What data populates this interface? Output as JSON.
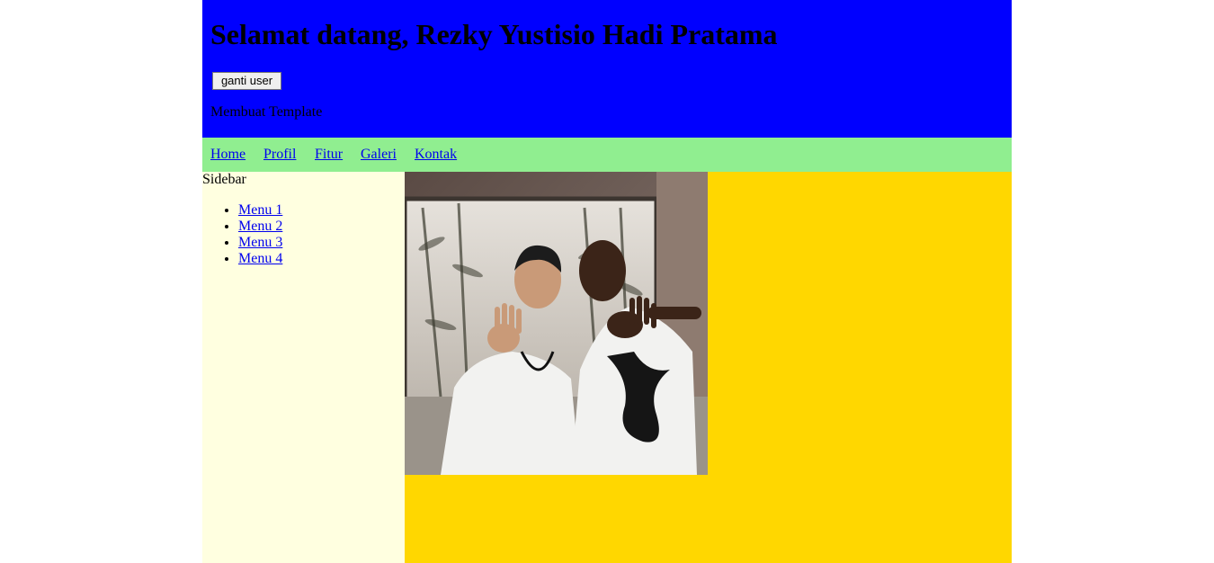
{
  "header": {
    "title": "Selamat datang, Rezky Yustisio Hadi Pratama",
    "switch_user_label": "ganti user",
    "subtitle": "Membuat Template"
  },
  "nav": {
    "items": [
      {
        "label": "Home"
      },
      {
        "label": "Profil"
      },
      {
        "label": "Fitur"
      },
      {
        "label": "Galeri"
      },
      {
        "label": "Kontak"
      }
    ]
  },
  "sidebar": {
    "title": "Sidebar",
    "items": [
      {
        "label": "Menu 1"
      },
      {
        "label": "Menu 2"
      },
      {
        "label": "Menu 3"
      },
      {
        "label": "Menu 4"
      }
    ]
  },
  "colors": {
    "header_bg": "#0000ff",
    "nav_bg": "#90ee90",
    "sidebar_bg": "#ffffe0",
    "content_bg": "#ffd700",
    "link": "#0000ee"
  },
  "content": {
    "image_icon": "photo-two-men-posing"
  }
}
